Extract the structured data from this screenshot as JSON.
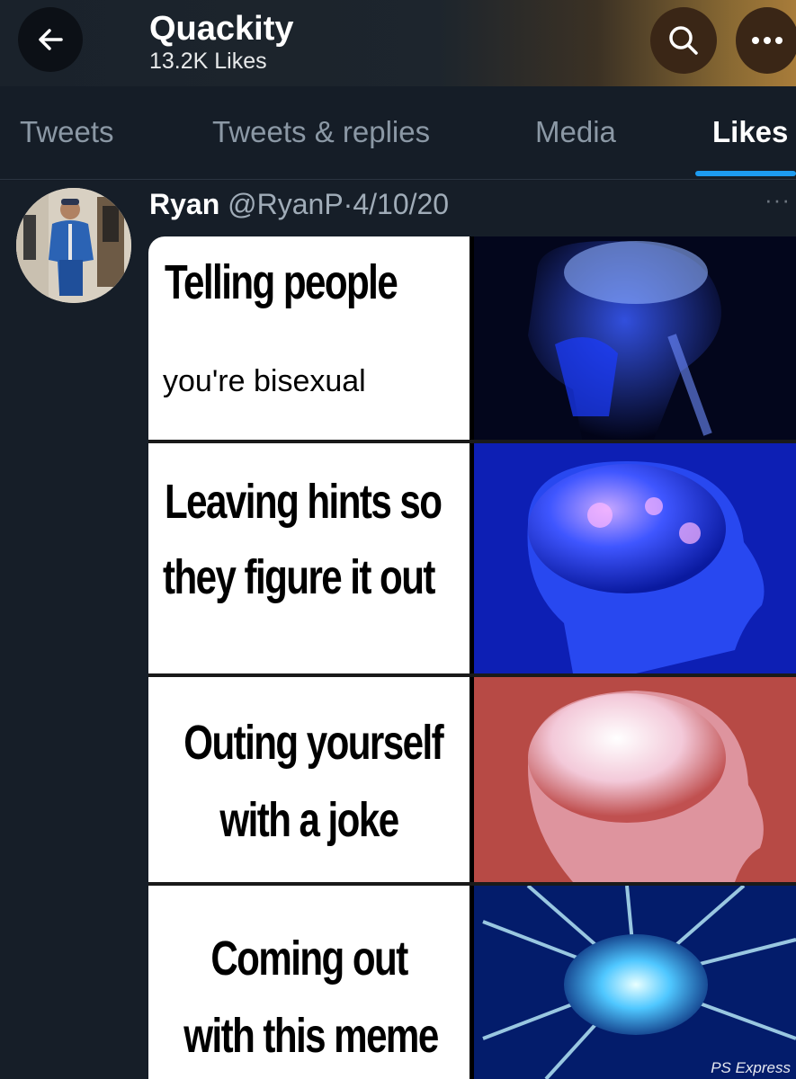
{
  "header": {
    "back_label": "←",
    "title": "Quackity",
    "subtitle": "13.2K Likes"
  },
  "tabs": [
    {
      "label": "Tweets"
    },
    {
      "label": "Tweets & replies"
    },
    {
      "label": "Media"
    },
    {
      "label": "Likes",
      "active": true
    }
  ],
  "tweet": {
    "name": "Ryan",
    "handle": "@RyanP",
    "separator": "·",
    "date": "4/10/20",
    "more": "···"
  },
  "meme": {
    "panels": [
      {
        "line1": "Telling people",
        "line2": "you're bisexual"
      },
      {
        "line1": "Leaving hints so",
        "line2": "they figure it out"
      },
      {
        "line1": "Outing yourself",
        "line2": "with a joke"
      },
      {
        "line1": "Coming out",
        "line2": "with this meme"
      }
    ],
    "watermark": "PS Express"
  },
  "colors": {
    "background": "#141c26",
    "accent": "#1d9bf0",
    "header_gold": "#a87c3a"
  },
  "icons": [
    "arrow-left-icon",
    "search-icon",
    "more-icon"
  ]
}
